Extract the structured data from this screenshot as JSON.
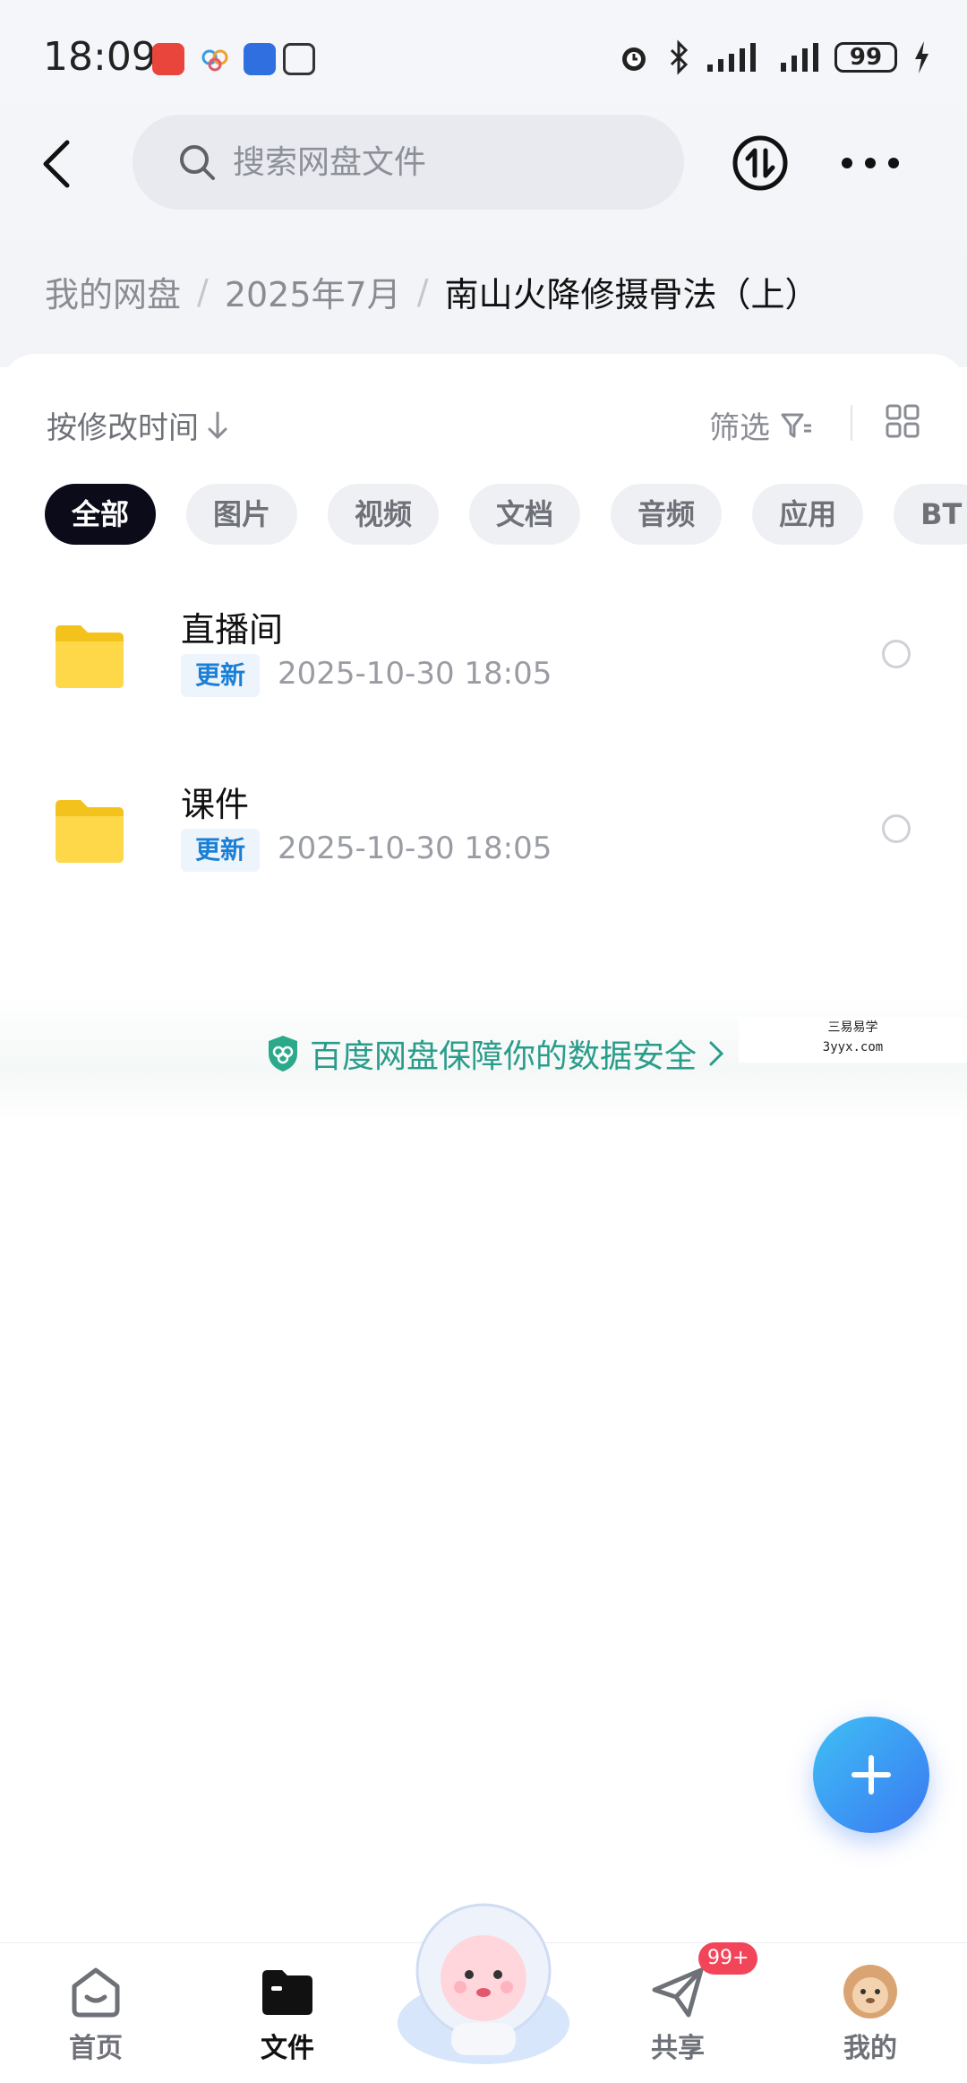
{
  "status_bar": {
    "time": "18:09",
    "battery": "99"
  },
  "header": {
    "search_placeholder": "搜索网盘文件"
  },
  "breadcrumb": {
    "items": [
      "我的网盘",
      "2025年7月"
    ],
    "separator": "/",
    "current": "南山火降修摄骨法（上）"
  },
  "toolbar": {
    "sort_label": "按修改时间",
    "filter_label": "筛选"
  },
  "chips": [
    {
      "label": "全部",
      "active": true
    },
    {
      "label": "图片",
      "active": false
    },
    {
      "label": "视频",
      "active": false
    },
    {
      "label": "文档",
      "active": false
    },
    {
      "label": "音频",
      "active": false
    },
    {
      "label": "应用",
      "active": false
    },
    {
      "label": "BT",
      "active": false
    }
  ],
  "files": [
    {
      "name": "直播间",
      "badge": "更新",
      "date": "2025-10-30  18:05"
    },
    {
      "name": "课件",
      "badge": "更新",
      "date": "2025-10-30  18:05"
    }
  ],
  "security_banner": {
    "text": "百度网盘保障你的数据安全"
  },
  "watermark": {
    "line1": "三易易学",
    "line2": "3yyx.com"
  },
  "bottom_nav": {
    "items": [
      {
        "label": "首页"
      },
      {
        "label": "文件"
      },
      {
        "label": "共享"
      },
      {
        "label": "我的"
      }
    ],
    "share_badge": "99+"
  },
  "colors": {
    "accent": "#3a78f2",
    "update_badge": "#1a7fd6",
    "security_text": "#2a9c8a",
    "notification_badge": "#f2455a"
  }
}
